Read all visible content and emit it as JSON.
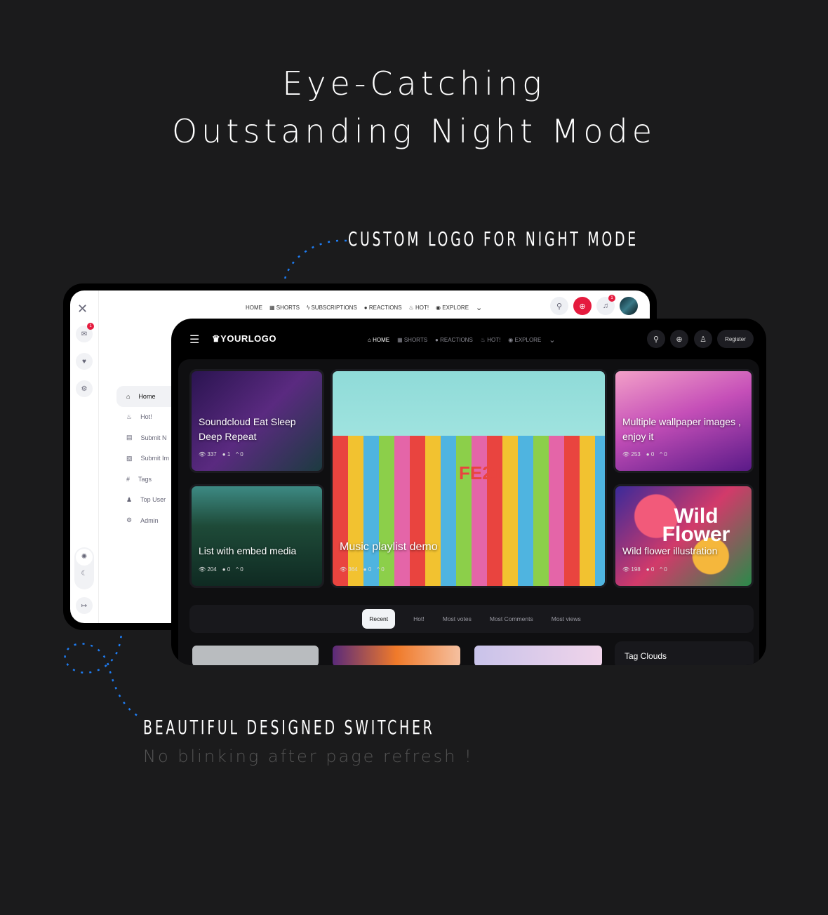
{
  "headline": {
    "line1": "Eye-Catching",
    "line2": "Outstanding Night Mode"
  },
  "callouts": {
    "logo": "CUSTOM LOGO FOR NIGHT MODE",
    "switcher": "BEAUTIFUL DESIGNED SWITCHER",
    "switcher_sub": "No blinking after page refresh !"
  },
  "light": {
    "nav": [
      {
        "icon": "home-icon",
        "label": "HOME"
      },
      {
        "icon": "clapper-icon",
        "label": "SHORTS"
      },
      {
        "icon": "bolt-icon",
        "label": "SUBSCRIPTIONS"
      },
      {
        "icon": "reaction-icon",
        "label": "REACTIONS"
      },
      {
        "icon": "fire-icon",
        "label": "HOT!"
      },
      {
        "icon": "compass-icon",
        "label": "EXPLORE"
      }
    ],
    "notif_count": "1",
    "mail_count": "1",
    "menu": [
      {
        "icon": "home-icon",
        "label": "Home"
      },
      {
        "icon": "fire-icon",
        "label": "Hot!"
      },
      {
        "icon": "news-icon",
        "label": "Submit N"
      },
      {
        "icon": "image-icon",
        "label": "Submit Im"
      },
      {
        "icon": "hash-icon",
        "label": "Tags"
      },
      {
        "icon": "users-icon",
        "label": "Top User"
      },
      {
        "icon": "gear-icon",
        "label": "Admin"
      }
    ]
  },
  "dark": {
    "logo": "YOURLOGO",
    "nav": [
      {
        "icon": "home-icon",
        "label": "HOME"
      },
      {
        "icon": "clapper-icon",
        "label": "SHORTS"
      },
      {
        "icon": "reaction-icon",
        "label": "REACTIONS"
      },
      {
        "icon": "fire-icon",
        "label": "HOT!"
      },
      {
        "icon": "compass-icon",
        "label": "EXPLORE"
      }
    ],
    "register": "Register",
    "cards": [
      {
        "title": "Soundcloud Eat Sleep Deep Repeat",
        "views": "337",
        "comments": "1",
        "votes": "0"
      },
      {
        "title": "List with embed media",
        "views": "204",
        "comments": "0",
        "votes": "0"
      },
      {
        "title": "Music playlist demo",
        "views": "364",
        "comments": "0",
        "votes": "0",
        "image_text": "FE21"
      },
      {
        "title": "Multiple wallpaper images , enjoy it",
        "views": "253",
        "comments": "0",
        "votes": "0"
      },
      {
        "title": "Wild flower illustration",
        "views": "198",
        "comments": "0",
        "votes": "0",
        "image_text": "Wild Flower"
      }
    ],
    "tabs": [
      "Recent",
      "Hot!",
      "Most votes",
      "Most Comments",
      "Most views"
    ],
    "widget_title": "Tag Clouds"
  }
}
